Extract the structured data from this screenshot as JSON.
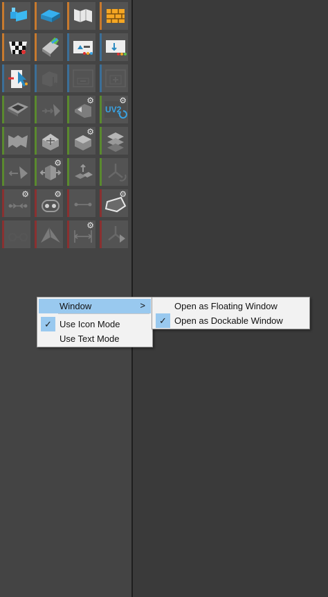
{
  "toolbar": {
    "tools": [
      {
        "name": "box-map-icon"
      },
      {
        "name": "planar-map-icon"
      },
      {
        "name": "cylinder-unwrap-icon"
      },
      {
        "name": "brick-pattern-icon"
      },
      {
        "name": "checker-map-icon"
      },
      {
        "name": "paint-brush-icon"
      },
      {
        "name": "load-uv-icon"
      },
      {
        "name": "uv-channel-icon"
      },
      {
        "name": "select-vertex-icon"
      },
      {
        "name": "select-face-icon"
      },
      {
        "name": "remove-seam-icon"
      },
      {
        "name": "add-seam-icon"
      },
      {
        "name": "flatten-uv-icon"
      },
      {
        "name": "peel-arrows-icon"
      },
      {
        "name": "relax-uv-icon"
      },
      {
        "name": "uv2-channel-icon"
      },
      {
        "name": "fold-map-icon"
      },
      {
        "name": "pelt-cube-icon"
      },
      {
        "name": "pelt-settings-icon"
      },
      {
        "name": "stack-shells-icon"
      },
      {
        "name": "weld-uv-icon"
      },
      {
        "name": "stitch-uv-icon"
      },
      {
        "name": "break-uv-icon"
      },
      {
        "name": "split-edge-icon"
      },
      {
        "name": "align-vertex-icon"
      },
      {
        "name": "pin-vertex-icon"
      },
      {
        "name": "straighten-edge-icon"
      },
      {
        "name": "shape-outline-icon"
      },
      {
        "name": "constraint-icon"
      },
      {
        "name": "fold-wing-icon"
      },
      {
        "name": "distance-measure-icon"
      },
      {
        "name": "split-branch-icon"
      }
    ]
  },
  "context_menu": {
    "window_label": "Window",
    "submenu_arrow": ">",
    "icon_mode_label": "Use Icon Mode",
    "icon_mode_check": "✓",
    "text_mode_label": "Use Text Mode"
  },
  "submenu": {
    "floating_label": "Open as Floating Window",
    "dockable_label": "Open as Dockable Window",
    "dockable_check": "✓"
  },
  "colors": {
    "orange": "#c87a2e",
    "blue": "#3b6f98",
    "green": "#5a8a2e",
    "red": "#8a3030",
    "highlight": "#99c9ef",
    "menu_bg": "#f2f2f2",
    "panel_bg": "#444444"
  }
}
